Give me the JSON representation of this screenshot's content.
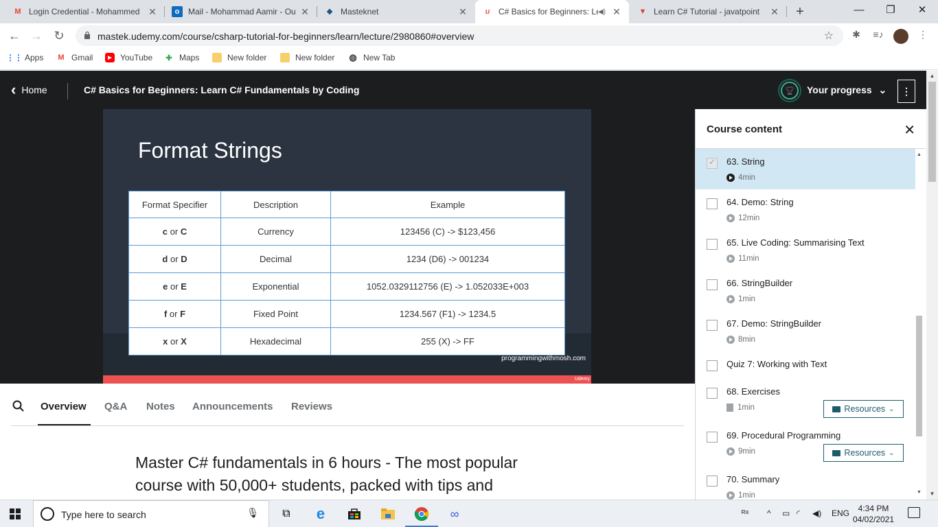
{
  "browser": {
    "tabs": [
      {
        "title": "Login Credential - Mohammed",
        "favicon": "gmail-icon"
      },
      {
        "title": "Mail - Mohammad Aamir - Ou",
        "favicon": "outlook-icon"
      },
      {
        "title": "Masteknet",
        "favicon": "masteknet-icon"
      },
      {
        "title": "C# Basics for Beginners: Le",
        "favicon": "udemy-icon"
      },
      {
        "title": "Learn C# Tutorial - javatpoint",
        "favicon": "javatpoint-icon"
      }
    ],
    "url": "mastek.udemy.com/course/csharp-tutorial-for-beginners/learn/lecture/2980860#overview",
    "bookmarks": [
      {
        "label": "Apps"
      },
      {
        "label": "Gmail"
      },
      {
        "label": "YouTube"
      },
      {
        "label": "Maps"
      },
      {
        "label": "New folder"
      },
      {
        "label": "New folder"
      },
      {
        "label": "New Tab"
      }
    ]
  },
  "header": {
    "home_label": "Home",
    "course_title": "C# Basics for Beginners: Learn C# Fundamentals by Coding",
    "progress_label": "Your progress"
  },
  "slide": {
    "title": "Format Strings",
    "columns": [
      "Format Specifier",
      "Description",
      "Example"
    ],
    "rows": [
      {
        "lower": "c",
        "or": "or",
        "upper": "C",
        "description": "Currency",
        "example": "123456 (C) -> $123,456"
      },
      {
        "lower": "d",
        "or": "or",
        "upper": "D",
        "description": "Decimal",
        "example": "1234 (D6) -> 001234"
      },
      {
        "lower": "e",
        "or": "or",
        "upper": "E",
        "description": "Exponential",
        "example": "1052.0329112756 (E) -> 1.052033E+003"
      },
      {
        "lower": "f",
        "or": "or",
        "upper": "F",
        "description": "Fixed Point",
        "example": "1234.567 (F1) -> 1234.5"
      },
      {
        "lower": "x",
        "or": "or",
        "upper": "X",
        "description": "Hexadecimal",
        "example": "255 (X) -> FF"
      }
    ],
    "watermark": "programmingwithmosh.com",
    "brand_mark": "Udemy"
  },
  "course_tabs": {
    "items": [
      {
        "label": "Overview"
      },
      {
        "label": "Q&A"
      },
      {
        "label": "Notes"
      },
      {
        "label": "Announcements"
      },
      {
        "label": "Reviews"
      }
    ],
    "active_index": 0
  },
  "overview": {
    "description_line1": "Master C# fundamentals in 6 hours - The most popular",
    "description_line2": "course with 50,000+ students, packed with tips and"
  },
  "sidebar": {
    "title": "Course content",
    "lectures": [
      {
        "title": "63. String",
        "duration": "4min",
        "kind": "video",
        "checked": true,
        "current": true
      },
      {
        "title": "64. Demo: String",
        "duration": "12min",
        "kind": "video",
        "checked": false
      },
      {
        "title": "65. Live Coding: Summarising Text",
        "duration": "11min",
        "kind": "video",
        "checked": false
      },
      {
        "title": "66. StringBuilder",
        "duration": "1min",
        "kind": "video",
        "checked": false
      },
      {
        "title": "67. Demo: StringBuilder",
        "duration": "8min",
        "kind": "video",
        "checked": false
      },
      {
        "title": "Quiz 7: Working with Text",
        "duration": "",
        "kind": "quiz",
        "checked": false
      },
      {
        "title": "68. Exercises",
        "duration": "1min",
        "kind": "document",
        "checked": false,
        "resources_label": "Resources"
      },
      {
        "title": "69. Procedural Programming",
        "duration": "9min",
        "kind": "video",
        "checked": false,
        "resources_label": "Resources"
      },
      {
        "title": "70. Summary",
        "duration": "1min",
        "kind": "video",
        "checked": false
      }
    ]
  },
  "taskbar": {
    "search_placeholder": "Type here to search",
    "language": "ENG",
    "time": "4:34 PM",
    "date": "04/02/2021"
  },
  "colors": {
    "udemy_dark": "#1c1d1f",
    "udemy_red": "#ec5252",
    "current_lecture_bg": "#d1e7f3",
    "resources_teal": "#1c5d6b",
    "slide_bg": "#2b3440",
    "table_border": "#5b9bd5"
  }
}
